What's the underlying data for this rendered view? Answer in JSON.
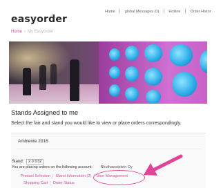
{
  "header": {
    "logo": "easyorder",
    "nav": [
      "Home",
      "global Messages (0)",
      "Hotline",
      "Order Histor"
    ]
  },
  "breadcrumb": {
    "home": "Home",
    "current": "My Easyorder"
  },
  "section": {
    "title": "Stands Assigned to me",
    "description": "Select the fair and stand you would like to view or place orders correspondingly."
  },
  "fair": {
    "name": "Ambiente 2016",
    "stand_label": "Stand:",
    "stand_value": "2.0 D32",
    "account_text": "You are placing orders on the following account:",
    "account_name": "Nhuthawatstein Oy"
  },
  "links": {
    "product_selection": "Product Selection",
    "stand_information": "Stand Information (2)",
    "user_management": "User Management",
    "shopping_cart": "Shopping Cart",
    "order_status": "Order Status"
  },
  "colors": {
    "accent": "#e0459a",
    "highlight": "#e0459a"
  }
}
